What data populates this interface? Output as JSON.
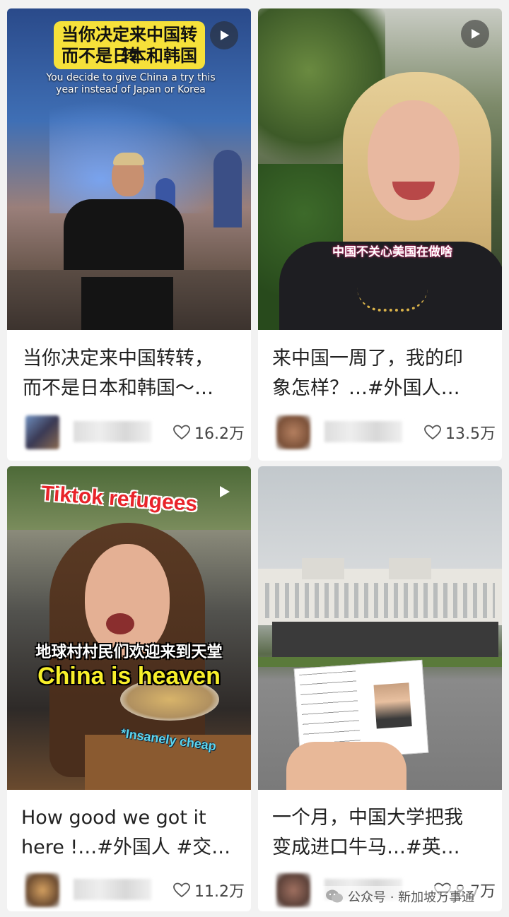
{
  "cards": [
    {
      "overlay_cn_line1": "当你决定来中国转转",
      "overlay_cn_line2": "而不是日本和韩国",
      "overlay_en": "You decide to give China a try this year instead of Japan or Korea",
      "caption_line1": "当你决定来中国转转，",
      "caption_line2": "而不是日本和韩国～…",
      "likes": "16.2万"
    },
    {
      "overlay_cn": "中国不关心美国在做啥",
      "caption_line1": "来中国一周了，我的印",
      "caption_line2": "象怎样？…#外国人…",
      "likes": "13.5万"
    },
    {
      "overlay_top": "Tiktok refugees",
      "overlay_cn": "地球村村民们欢迎来到天堂",
      "overlay_en": "China is heaven",
      "overlay_note": "*Insanely cheap",
      "caption_line1": "How good we got it",
      "caption_line2": "here !…#外国人 #交…",
      "likes": "11.2万"
    },
    {
      "caption_line1": "一个月，中国大学把我",
      "caption_line2": "变成进口牛马…#英…",
      "likes": "8.7万"
    }
  ],
  "watermark": "公众号 · 新加坡万事通"
}
